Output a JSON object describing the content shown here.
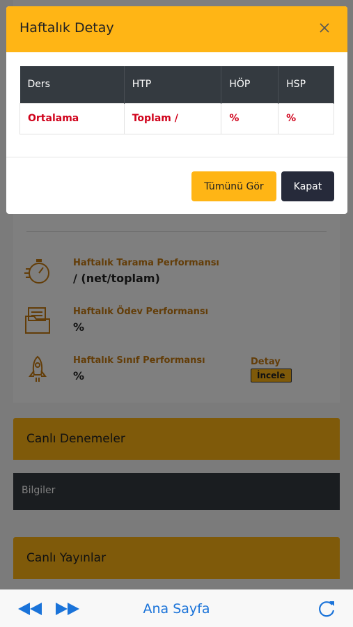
{
  "modal": {
    "title": "Haftalık Detay",
    "table": {
      "headers": [
        "Ders",
        "HTP",
        "HÖP",
        "HSP"
      ],
      "rows": [
        [
          "Ortalama",
          "Toplam /",
          "%",
          "%"
        ]
      ]
    },
    "buttons": {
      "all": "Tümünü Gör",
      "close": "Kapat"
    }
  },
  "background": {
    "performance": [
      {
        "icon": "stopwatch-icon",
        "title": "Haftalık Tarama Performansı",
        "value": "/ (net/toplam)"
      },
      {
        "icon": "folder-icon",
        "title": "Haftalık Ödev Performansı",
        "value": "%"
      },
      {
        "icon": "rocket-icon",
        "title": "Haftalık Sınıf Performansı",
        "value": "%"
      }
    ],
    "detail_label": "Detay",
    "inspect_button": "İncele",
    "sections": {
      "live_exams": "Canlı Denemeler",
      "info": "Bilgiler",
      "live_streams": "Canlı Yayınlar"
    }
  },
  "toolbar": {
    "home": "Ana Sayfa"
  },
  "colors": {
    "accent": "#ffb515",
    "dark": "#343a40",
    "link": "#1a73d9",
    "highlight": "#d0021b"
  }
}
